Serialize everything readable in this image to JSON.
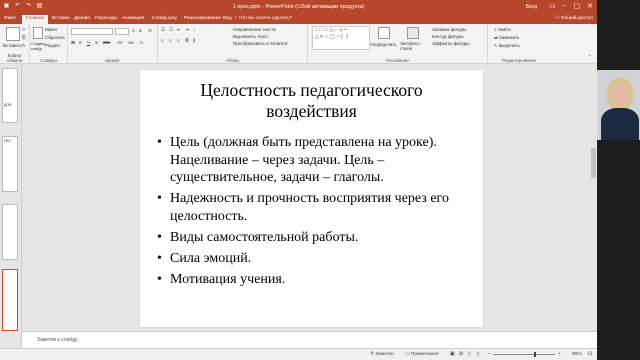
{
  "window": {
    "title": "1 през.pptx - PowerPoint (Сбой активации продукта)",
    "login_label": "Вход",
    "controls": [
      "▭",
      "–",
      "▢",
      "✕"
    ]
  },
  "tabs": {
    "file": "Файл",
    "items": [
      "Главная",
      "Вставка",
      "Дизайн",
      "Переходы",
      "Анимация",
      "Слайд-шоу",
      "Рецензирование",
      "Вид"
    ],
    "active_index": 0,
    "tell_me": "Что вы хотите сделать?",
    "share": "Общий доступ"
  },
  "ribbon": {
    "clipboard": {
      "paste": "Вставить",
      "label": "Буфер обмена"
    },
    "slides": {
      "new_slide": "Создать слайд",
      "layout": "Макет",
      "reset": "Сбросить",
      "section": "Раздел",
      "label": "Слайды"
    },
    "font": {
      "label": "Шрифт"
    },
    "paragraph": {
      "text_direction": "Направление текста",
      "align_text": "Выровнять текст",
      "smartart": "Преобразовать в SmartArt",
      "label": "Абзац"
    },
    "drawing": {
      "arrange": "Упорядочить",
      "quick_styles": "Экспресс-стили",
      "fill": "Заливка фигуры",
      "outline": "Контур фигуры",
      "effects": "Эффекты фигуры",
      "label": "Рисование"
    },
    "editing": {
      "find": "Найти",
      "replace": "Заменить",
      "select": "Выделить",
      "label": "Редактирование"
    }
  },
  "thumbnails": [
    {
      "number": "",
      "text": "ДОВ"
    },
    {
      "number": "",
      "text": "ПЕС"
    },
    {
      "number": "",
      "text": ""
    },
    {
      "number": "",
      "text": ""
    },
    {
      "number": "",
      "text": ""
    }
  ],
  "slide": {
    "title": "Целостность педагогического воздействия",
    "bullets": [
      "Цель (должная быть представлена на уроке). Нацеливание – через задачи. Цель – существительное, задачи – глаголы.",
      "Надежность и прочность восприятия через его целостность.",
      "Виды самостоятельной работы.",
      "Сила эмоций.",
      "Мотивация учения."
    ]
  },
  "notes": {
    "placeholder": "Заметки к слайду"
  },
  "status": {
    "notes_btn": "Заметки",
    "comments_btn": "Примечания",
    "zoom": "98%"
  },
  "colors": {
    "accent": "#b7472a",
    "ribbon_bg": "#f3f3f3",
    "work_bg": "#e6e6e6"
  }
}
